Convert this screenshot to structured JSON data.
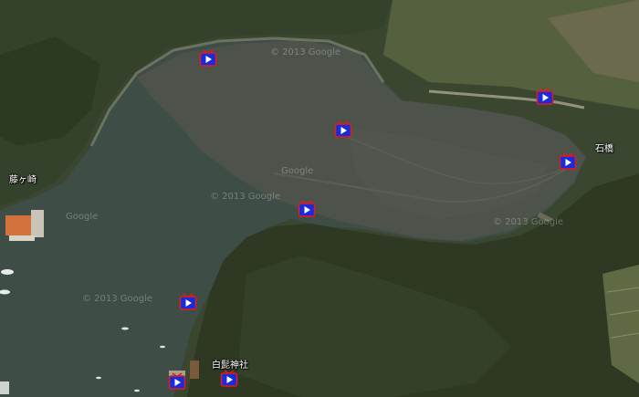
{
  "place_labels": {
    "fujigasaki": "藤ヶ崎",
    "ishibashi": "石橋",
    "hakuhige_shrine": "白髭神社"
  },
  "watermarks": {
    "a": "© 2013 Google",
    "b": "© 2013 Google",
    "c": "Google",
    "d": "© 2013 Google",
    "e": "Google",
    "f": "© 2013 Google"
  },
  "marker_icon": "video-play-icon",
  "colors": {
    "marker_fill": "#1a2bdc",
    "marker_border": "#e21b1b",
    "play_triangle": "#ffffff",
    "tidal_flat": "#4f544c",
    "water": "#3d4e45",
    "forest": "#2f3a24"
  }
}
